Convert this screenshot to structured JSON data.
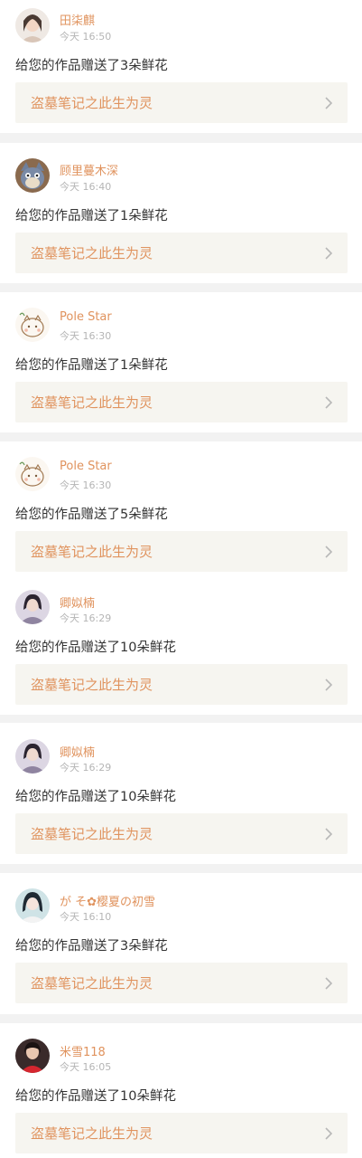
{
  "colors": {
    "accent": "#e0935e",
    "time": "#b5b5b5",
    "text": "#333333",
    "work_bg": "#f6f5f0",
    "page_bg": "#f2f2f2",
    "card_bg": "#ffffff"
  },
  "work_title": "盗墓笔记之此生为灵",
  "notifications": [
    {
      "user": "田柒麒",
      "time": "今天 16:50",
      "message": "给您的作品赠送了3朵鲜花",
      "avatar_icon": "user-avatar-icon"
    },
    {
      "user": "顾里蔓木深",
      "time": "今天 16:40",
      "message": "给您的作品赠送了1朵鲜花",
      "avatar_icon": "cartoon-cat-avatar-icon"
    },
    {
      "user": "Pole Star",
      "time": "今天 16:30",
      "message": "给您的作品赠送了1朵鲜花",
      "avatar_icon": "doodle-avatar-icon"
    },
    {
      "user": "Pole Star",
      "time": "今天 16:30",
      "message": "给您的作品赠送了5朵鲜花",
      "avatar_icon": "doodle-avatar-icon"
    },
    {
      "user": "卿姒楠",
      "time": "今天 16:29",
      "message": "给您的作品赠送了10朵鲜花",
      "avatar_icon": "user-avatar-icon"
    },
    {
      "user": "卿姒楠",
      "time": "今天 16:29",
      "message": "给您的作品赠送了10朵鲜花",
      "avatar_icon": "user-avatar-icon"
    },
    {
      "user": "が そ✿樱夏の初雪",
      "time": "今天 16:10",
      "message": "给您的作品赠送了3朵鲜花",
      "avatar_icon": "user-avatar-icon"
    },
    {
      "user": "米雪118",
      "time": "今天 16:05",
      "message": "给您的作品赠送了10朵鲜花",
      "avatar_icon": "user-avatar-icon"
    }
  ]
}
